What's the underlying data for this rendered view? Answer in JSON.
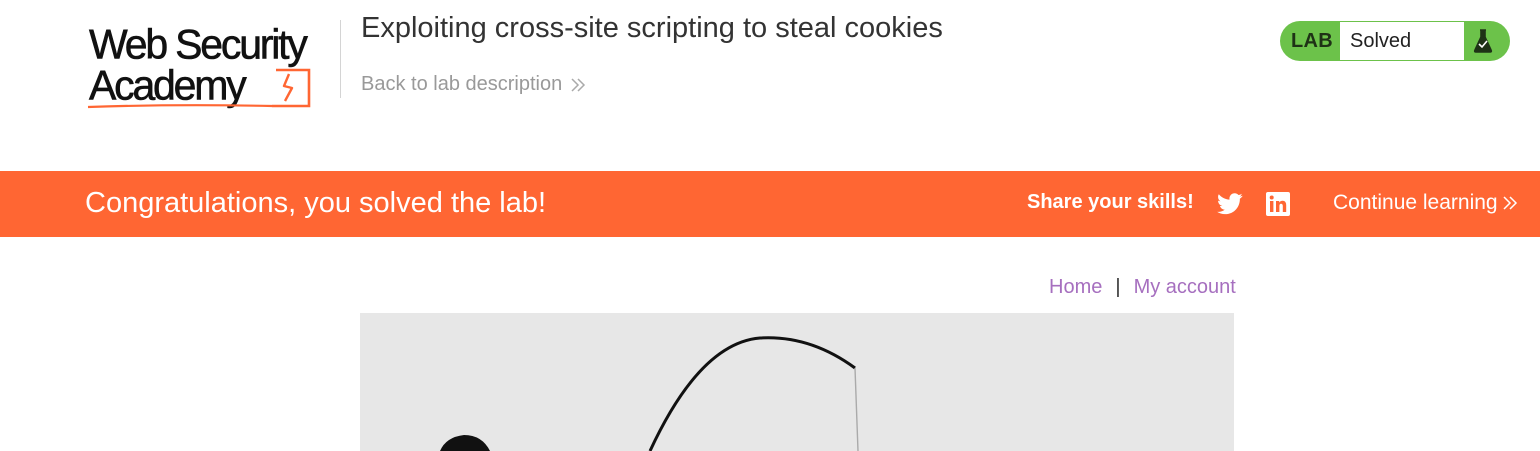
{
  "header": {
    "logo": {
      "line1": "Web Security",
      "line2": "Academy"
    },
    "lab_title": "Exploiting cross-site scripting to steal cookies",
    "back_link": "Back to lab description",
    "lab_status": {
      "label": "LAB",
      "state": "Solved"
    }
  },
  "banner": {
    "message": "Congratulations, you solved the lab!",
    "share_label": "Share your skills!",
    "continue_label": "Continue learning"
  },
  "nav": {
    "home": "Home",
    "separator": "|",
    "my_account": "My account"
  },
  "colors": {
    "accent_orange": "#ff6633",
    "lab_green": "#6cc24a",
    "nav_link_purple": "#a66fbf",
    "hero_bg": "#e7e7e7"
  },
  "icons": {
    "logo_mark": "lightning-bracket-icon",
    "back_chevron": "double-chevron-right-icon",
    "flask": "flask-icon",
    "twitter": "twitter-icon",
    "linkedin": "linkedin-icon",
    "continue_chevron": "double-chevron-right-icon"
  }
}
